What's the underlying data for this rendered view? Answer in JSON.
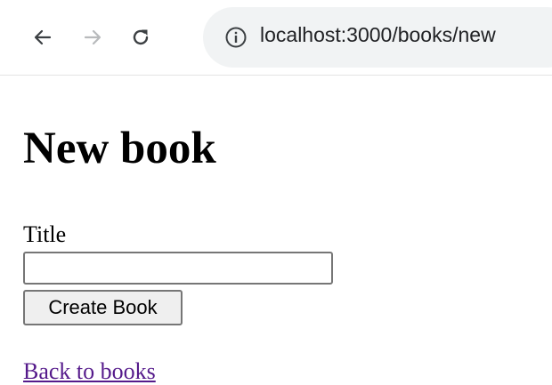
{
  "browser": {
    "url": "localhost:3000/books/new",
    "icons": {
      "back": "arrow-left-icon",
      "forward": "arrow-right-icon",
      "reload": "reload-icon",
      "info": "info-circle-icon"
    }
  },
  "page": {
    "title": "New book",
    "form": {
      "title_label": "Title",
      "title_value": "",
      "submit_label": "Create Book"
    },
    "back_link": "Back to books"
  },
  "colors": {
    "link_visited": "#551a8b",
    "omnibox_bg": "#f1f3f4",
    "button_bg": "#efefef"
  }
}
